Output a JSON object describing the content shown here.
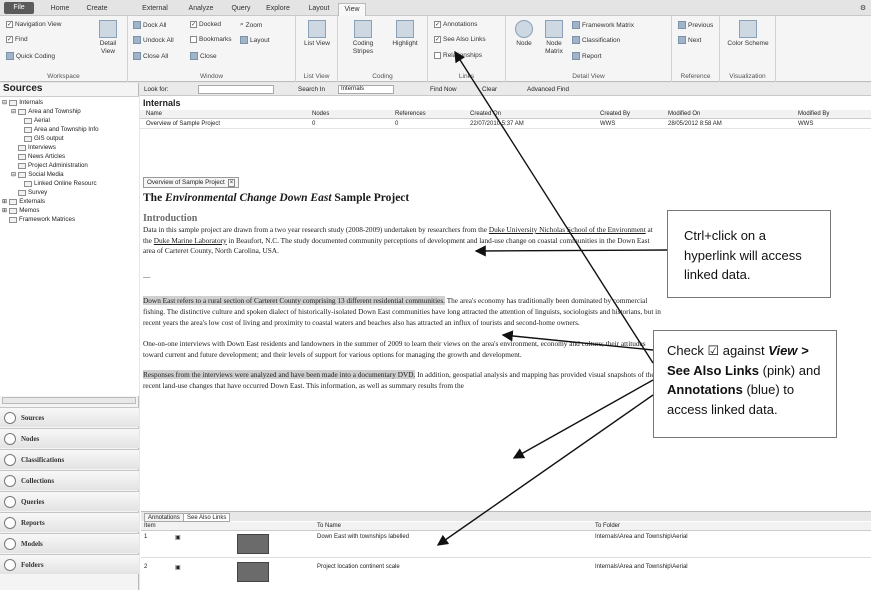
{
  "tabs": [
    "File",
    "Home",
    "Create",
    "External Data",
    "Analyze",
    "Query",
    "Explore",
    "Layout",
    "View"
  ],
  "ribbon": {
    "workspace": {
      "label": "Workspace",
      "items": [
        "Navigation View",
        "Find",
        "Quick Coding"
      ],
      "detail": "Detail View"
    },
    "window": {
      "label": "Window",
      "items": [
        "Dock All",
        "Undock All",
        "Close All",
        "Docked",
        "Bookmarks",
        "Close",
        "Zoom",
        "Layout"
      ]
    },
    "list_view": {
      "label": "List View",
      "big": "List View"
    },
    "coding": {
      "label": "Coding",
      "items": [
        "Coding Stripes",
        "Highlight"
      ]
    },
    "links": {
      "label": "Links",
      "items": [
        "Annotations",
        "See Also Links",
        "Relationships"
      ]
    },
    "detail_view": {
      "label": "Detail View",
      "items": [
        "Node",
        "Node Matrix",
        "Framework Matrix",
        "Classification",
        "Report"
      ]
    },
    "reference": {
      "label": "Reference",
      "items": [
        "Previous",
        "Next"
      ]
    },
    "visualization": {
      "label": "Visualization",
      "items": [
        "Color Scheme"
      ]
    }
  },
  "sources": {
    "title": "Sources",
    "tree": [
      "Internals",
      "Area and Township",
      "Aerial",
      "Area and Township Info",
      "GIS output",
      "Interviews",
      "News Articles",
      "Project Administration",
      "Social Media",
      "Linked Online Resourc",
      "Survey",
      "Externals",
      "Memos",
      "Framework Matrices"
    ]
  },
  "nav_buttons": [
    "Sources",
    "Nodes",
    "Classifications",
    "Collections",
    "Queries",
    "Reports",
    "Models",
    "Folders"
  ],
  "findbar": {
    "look_for": "Look for:",
    "search_in": "Search In",
    "scope": "Internals",
    "find_now": "Find Now",
    "clear": "Clear",
    "advanced": "Advanced Find"
  },
  "list": {
    "title": "Internals",
    "columns": [
      "Name",
      "Nodes",
      "References",
      "Created On",
      "Created By",
      "Modified On",
      "Modified By"
    ],
    "rows": [
      [
        "Overview of Sample Project",
        "0",
        "0",
        "22/07/2010 5:37 AM",
        "WWS",
        "28/05/2012 8:58 AM",
        "WWS"
      ]
    ]
  },
  "doc": {
    "tab": "Overview of Sample Project",
    "heading_pre": "The ",
    "heading_italic": "Environmental Change Down East",
    "heading_post": " Sample Project",
    "sub": "Introduction",
    "p1_a": "Data in this sample project are drawn from a two year research study (2008-2009) undertaken by researchers from the ",
    "p1_link1": "Duke University Nicholas School of the Environment",
    "p1_b": " at the ",
    "p1_link2": "Duke Marine Laboratory",
    "p1_c": " in Beaufort, N.C. The study documented community perceptions of development and land-use change on coastal communities in the Down East area of Carteret County, North Carolina, USA.",
    "dash": "—",
    "p2_hl": "Down East refers to a rural section of Carteret County comprising 13 different residential communities.",
    "p2_rest": " The area's economy has traditionally been dominated by commercial fishing. The distinctive culture and spoken dialect of historically-isolated Down East communities have long attracted the attention of linguists, sociologists and historians, but in recent years the area's low cost of living and proximity to coastal waters and beaches also has attracted an influx of tourists and second-home owners.",
    "p3": "One-on-one interviews with Down East residents and landowners in the summer of 2009 to learn their views on the area's environment, economy and culture; their attitudes toward current and future development; and their levels of support for various options for managing the growth and development.",
    "p4_hl": "Responses from the interviews were analyzed and have been made into a documentary DVD.",
    "p4_rest": " In addition, geospatial analysis and mapping has provided visual snapshots of the recent land-use changes that have occurred Down East. This information, as well as summary results from the"
  },
  "annotations": {
    "tabs": [
      "Annotations",
      "See Also Links"
    ],
    "columns": [
      "Item",
      "To Name",
      "To Folder"
    ],
    "rows": [
      [
        "1",
        "Down East with townships labelled",
        "Internals\\Area and Township\\Aerial"
      ],
      [
        "2",
        "Project location continent scale",
        "Internals\\Area and Township\\Aerial"
      ]
    ]
  },
  "callouts": {
    "c1": "Ctrl+click on a hyperlink will access linked data.",
    "c2_a": "Check ☑ against ",
    "c2_view": "View > ",
    "c2_see": "See Also Links",
    "c2_b": " (pink) and ",
    "c2_ann": "Annotations",
    "c2_c": " (blue) to access linked data."
  }
}
